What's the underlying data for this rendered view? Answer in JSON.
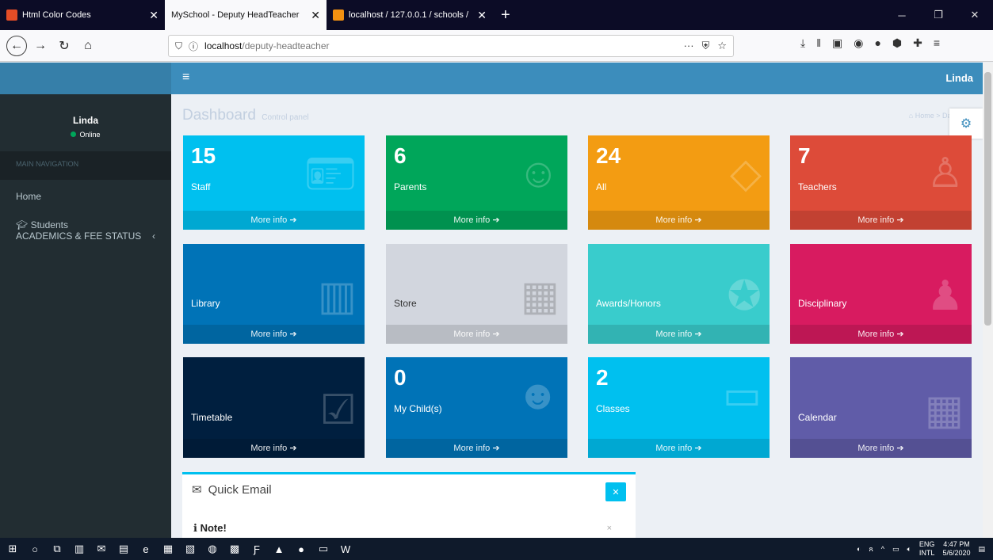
{
  "browser": {
    "tabs": [
      {
        "title": "Html Color Codes",
        "color": "#e44d26",
        "active": false
      },
      {
        "title": "MySchool - Deputy HeadTeacher",
        "color": "#f9f9fb",
        "active": true
      },
      {
        "title": "localhost / 127.0.0.1 / schools /",
        "color": "#f29111",
        "active": false
      }
    ],
    "url_host": "localhost",
    "url_path": "/deputy-headteacher"
  },
  "app": {
    "user": "Linda",
    "status": "Online",
    "nav_header": "MAIN NAVIGATION",
    "nav_home": "Home",
    "nav_students": "Students",
    "nav_academics": "ACADEMICS & FEE STATUS",
    "page_title": "Dashboard",
    "page_subtitle": "Control panel",
    "breadcrumb": "Home > Dash"
  },
  "boxes": [
    {
      "num": "15",
      "label": "Staff",
      "color": "#00c0ef",
      "icon": "id-card-icon"
    },
    {
      "num": "6",
      "label": "Parents",
      "color": "#00a65a",
      "icon": "people-icon"
    },
    {
      "num": "24",
      "label": "All",
      "color": "#f39c12",
      "icon": "arrows-icon"
    },
    {
      "num": "7",
      "label": "Teachers",
      "color": "#dd4b39",
      "icon": "teacher-icon"
    },
    {
      "num": "",
      "label": "Library",
      "color": "#0073b7",
      "icon": "books-icon"
    },
    {
      "num": "",
      "label": "Store",
      "color": "#d2d6de",
      "icon": "boxes-icon"
    },
    {
      "num": "",
      "label": "Awards/Honors",
      "color": "#39cccc",
      "icon": "award-icon"
    },
    {
      "num": "",
      "label": "Disciplinary",
      "color": "#d81b60",
      "icon": "discipline-icon"
    },
    {
      "num": "",
      "label": "Timetable",
      "color": "#001f3f",
      "icon": "calendar-check-icon"
    },
    {
      "num": "0",
      "label": "My Child(s)",
      "color": "#0073b7",
      "icon": "children-icon"
    },
    {
      "num": "2",
      "label": "Classes",
      "color": "#00c0ef",
      "icon": "board-icon"
    },
    {
      "num": "",
      "label": "Calendar",
      "color": "#605ca8",
      "icon": "calendar-icon"
    }
  ],
  "more_info": "More info",
  "email": {
    "title": "Quick Email",
    "note": "Note!"
  },
  "taskbar": {
    "lang1": "ENG",
    "lang2": "INTL",
    "time": "4:47 PM",
    "date": "5/6/2020"
  }
}
